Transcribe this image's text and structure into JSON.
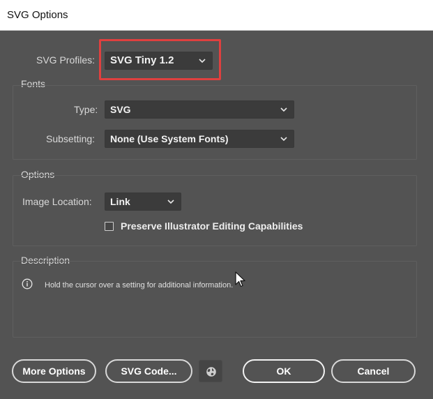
{
  "window": {
    "title": "SVG Options"
  },
  "svg_profiles": {
    "label": "SVG Profiles:",
    "value": "SVG Tiny 1.2"
  },
  "fonts": {
    "group_title": "Fonts",
    "type_label": "Type:",
    "type_value": "SVG",
    "subsetting_label": "Subsetting:",
    "subsetting_value": "None (Use System Fonts)"
  },
  "options": {
    "group_title": "Options",
    "image_location_label": "Image Location:",
    "image_location_value": "Link",
    "preserve_label": "Preserve Illustrator Editing Capabilities",
    "preserve_checked": false
  },
  "description": {
    "group_title": "Description",
    "text": "Hold the cursor over a setting for additional information."
  },
  "buttons": {
    "more_options": "More Options",
    "svg_code": "SVG Code...",
    "ok": "OK",
    "cancel": "Cancel"
  },
  "colors": {
    "background": "#535353",
    "highlight": "#e0403f",
    "dropdown": "#3b3b3b"
  },
  "icons": {
    "chevron": "chevron-down-icon",
    "info": "info-icon",
    "globe": "globe-icon",
    "cursor": "mouse-cursor-icon"
  }
}
